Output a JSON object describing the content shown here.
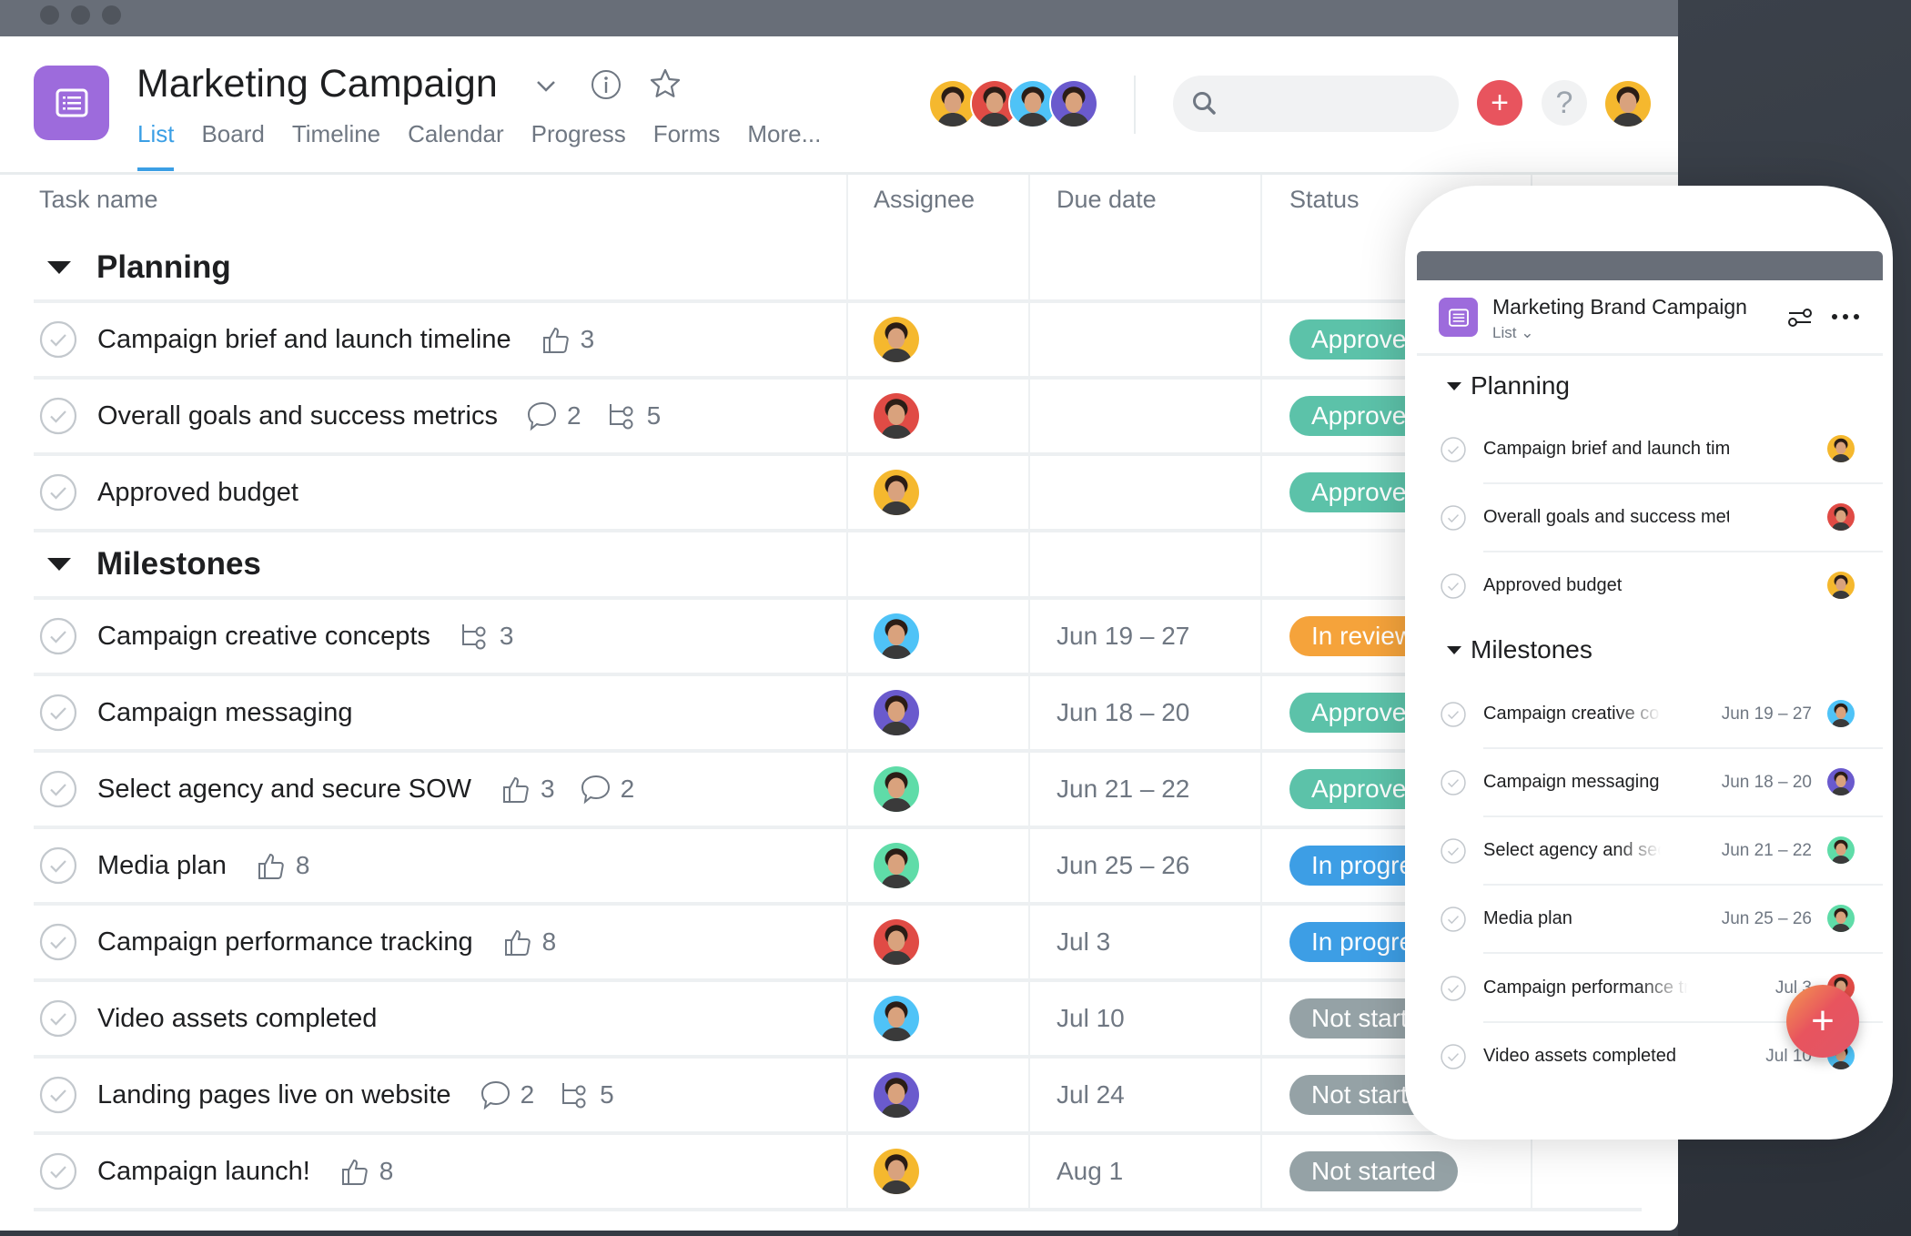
{
  "project": {
    "title": "Marketing Campaign",
    "icon": "list-icon",
    "accent": "#9d6bdc",
    "tabs": [
      {
        "label": "List",
        "active": true
      },
      {
        "label": "Board"
      },
      {
        "label": "Timeline"
      },
      {
        "label": "Calendar"
      },
      {
        "label": "Progress"
      },
      {
        "label": "Forms"
      },
      {
        "label": "More..."
      }
    ]
  },
  "header": {
    "members": [
      "yellow",
      "red",
      "blue",
      "purple"
    ],
    "search": {
      "placeholder": "",
      "value": ""
    },
    "add_label": "+",
    "help_label": "?"
  },
  "columns": {
    "task": "Task name",
    "assignee": "Assignee",
    "due": "Due date",
    "status": "Status"
  },
  "status_colors": {
    "Approved": "#5cc2a9",
    "In review": "#f5a33b",
    "In progress": "#3d9ee5",
    "Not started": "#95a2a6"
  },
  "avatar_colors": {
    "yellow": "#f5b82e",
    "red": "#e04b45",
    "blue": "#4fc3f7",
    "purple": "#6a5acd",
    "green": "#5fdca8"
  },
  "sections": [
    {
      "name": "Planning",
      "tasks": [
        {
          "name": "Campaign brief and launch timeline",
          "likes": 3,
          "assignee": "yellow",
          "due": "",
          "status": "Approved"
        },
        {
          "name": "Overall goals and success metrics",
          "comments": 2,
          "subtasks": 5,
          "assignee": "red",
          "due": "",
          "status": "Approved"
        },
        {
          "name": "Approved budget",
          "assignee": "yellow",
          "due": "",
          "status": "Approved"
        }
      ]
    },
    {
      "name": "Milestones",
      "tasks": [
        {
          "name": "Campaign creative concepts",
          "subtasks": 3,
          "assignee": "blue",
          "due": "Jun 19 – 27",
          "status": "In review"
        },
        {
          "name": "Campaign messaging",
          "assignee": "purple",
          "due": "Jun 18 – 20",
          "status": "Approved"
        },
        {
          "name": "Select agency and secure SOW",
          "likes": 3,
          "comments": 2,
          "assignee": "green",
          "due": "Jun 21 – 22",
          "status": "Approved"
        },
        {
          "name": "Media plan",
          "likes": 8,
          "assignee": "green",
          "due": "Jun 25 – 26",
          "status": "In progress"
        },
        {
          "name": "Campaign performance tracking",
          "likes": 8,
          "assignee": "red",
          "due": "Jul 3",
          "status": "In progress"
        },
        {
          "name": "Video assets completed",
          "assignee": "blue",
          "due": "Jul 10",
          "status": "Not started"
        },
        {
          "name": "Landing pages live on website",
          "comments": 2,
          "subtasks": 5,
          "assignee": "purple",
          "due": "Jul 24",
          "status": "Not started"
        },
        {
          "name": "Campaign launch!",
          "likes": 8,
          "assignee": "yellow",
          "due": "Aug 1",
          "status": "Not started"
        }
      ]
    }
  ],
  "mobile": {
    "title": "Marketing Brand Campaign",
    "view": "List",
    "sections": [
      {
        "name": "Planning",
        "tasks": [
          {
            "name": "Campaign brief and launch timeline",
            "due": "",
            "assignee": "yellow"
          },
          {
            "name": "Overall goals and success metrics",
            "due": "",
            "assignee": "red"
          },
          {
            "name": "Approved budget",
            "due": "",
            "assignee": "yellow"
          }
        ]
      },
      {
        "name": "Milestones",
        "tasks": [
          {
            "name": "Campaign creative concepts",
            "due": "Jun 19 – 27",
            "assignee": "blue"
          },
          {
            "name": "Campaign messaging",
            "due": "Jun 18 – 20",
            "assignee": "purple"
          },
          {
            "name": "Select agency and secure SOW",
            "due": "Jun 21 – 22",
            "assignee": "green"
          },
          {
            "name": "Media plan",
            "due": "Jun 25 – 26",
            "assignee": "green"
          },
          {
            "name": "Campaign performance tracking",
            "due": "Jul 3",
            "assignee": "red"
          },
          {
            "name": "Video assets completed",
            "due": "Jul 10",
            "assignee": "blue"
          }
        ]
      }
    ],
    "fab_label": "+"
  }
}
